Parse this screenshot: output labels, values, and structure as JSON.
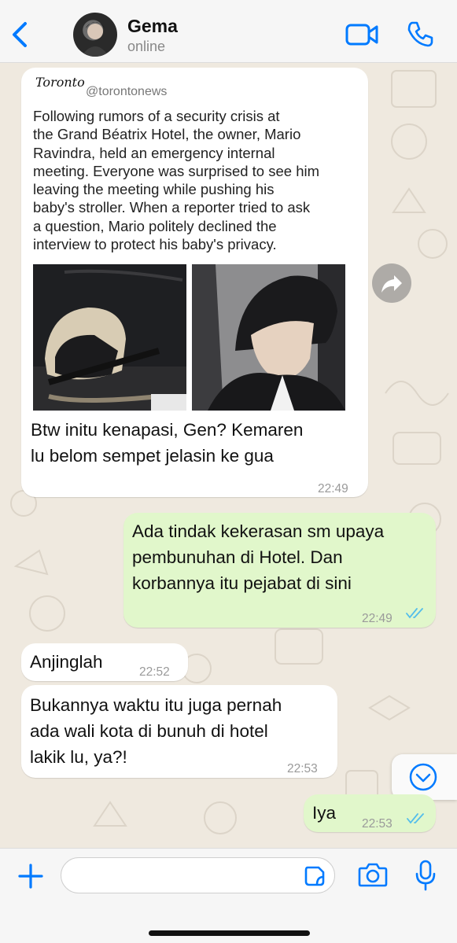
{
  "header": {
    "contact_name": "Gema",
    "status": "online"
  },
  "tweet": {
    "source_logo": "Toronto",
    "handle": "@torontonews",
    "text_lines": [
      "Following rumors of a security crisis at",
      "the Grand Béatrix Hotel, the owner, Mario",
      "Ravindra, held an emergency internal",
      "meeting. Everyone was surprised to see him",
      "leaving the meeting while pushing his",
      "baby's stroller. When a reporter tried to ask",
      "a question, Mario politely declined the",
      "interview to protect his baby's privacy."
    ]
  },
  "messages": [
    {
      "dir": "in",
      "lines": [
        "Btw initu kenapasi, Gen? Kemaren",
        "lu belom sempet jelasin ke gua"
      ],
      "time": "22:49"
    },
    {
      "dir": "out",
      "lines": [
        "Ada tindak kekerasan sm upaya",
        "pembunuhan di Hotel. Dan",
        "korbannya itu pejabat di sini"
      ],
      "time": "22:49",
      "read": true
    },
    {
      "dir": "in",
      "lines": [
        "Anjinglah"
      ],
      "time": "22:52"
    },
    {
      "dir": "in",
      "lines": [
        "Bukannya waktu itu juga pernah",
        "ada wali kota di bunuh di hotel",
        "lakik lu, ya?!"
      ],
      "time": "22:53"
    },
    {
      "dir": "out",
      "lines": [
        "Iya"
      ],
      "time": "22:53",
      "read": true
    }
  ],
  "input": {
    "placeholder": ""
  },
  "colors": {
    "accent": "#007aff",
    "outgoing_bubble": "#e1f7cb",
    "incoming_bubble": "#ffffff",
    "read_ticks": "#53bdeb",
    "chat_background": "#efe9df"
  },
  "icons": [
    "back-icon",
    "video-call-icon",
    "phone-call-icon",
    "share-icon",
    "scroll-down-icon",
    "plus-icon",
    "sticker-icon",
    "camera-icon",
    "mic-icon"
  ]
}
